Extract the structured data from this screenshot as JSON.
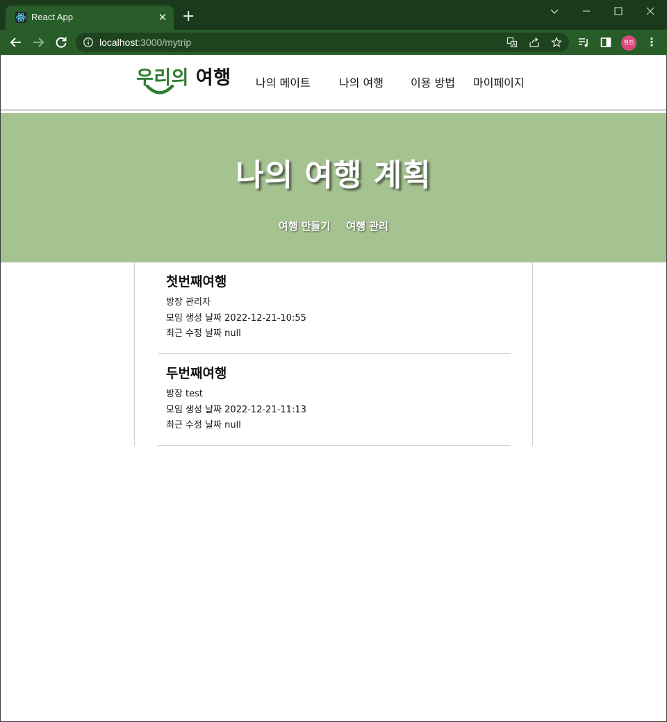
{
  "browser": {
    "tab_title": "React App",
    "new_tab_glyph": "+",
    "close_glyph": "✕",
    "url_host": "localhost",
    "url_rest": ":3000/mytrip",
    "profile_label": "현진",
    "menu_glyph": "⋮",
    "icons": [
      "react-favicon",
      "back-arrow-icon",
      "forward-arrow-icon",
      "reload-icon",
      "site-info-icon",
      "translate-icon",
      "share-icon",
      "bookmark-star-icon",
      "reading-list-icon",
      "side-panel-icon",
      "minimize-icon",
      "maximize-icon",
      "close-window-icon",
      "tab-search-icon"
    ]
  },
  "header": {
    "logo_green": "우리의",
    "logo_dark": " 여행",
    "menu": [
      "나의 메이트",
      "나의 여행",
      "이용 방법",
      "마이페이지"
    ]
  },
  "hero": {
    "title": "나의 여행 계획",
    "links": [
      "여행 만들기",
      "여행 관리"
    ]
  },
  "trips": [
    {
      "name": "첫번째여행",
      "owner": "방장 관리자",
      "created": "모임 생성 날짜 2022-12-21-10:55",
      "modified": "최근 수정 날짜 null"
    },
    {
      "name": "두번째여행",
      "owner": "방장 test",
      "created": "모임 생성 날짜 2022-12-21-11:13",
      "modified": "최근 수정 날짜 null"
    }
  ],
  "colors": {
    "chrome_dark": "#1b3a1c",
    "chrome_tab": "#285d2a",
    "hero_bg": "#a5c391",
    "logo_green": "#2e7d32"
  }
}
